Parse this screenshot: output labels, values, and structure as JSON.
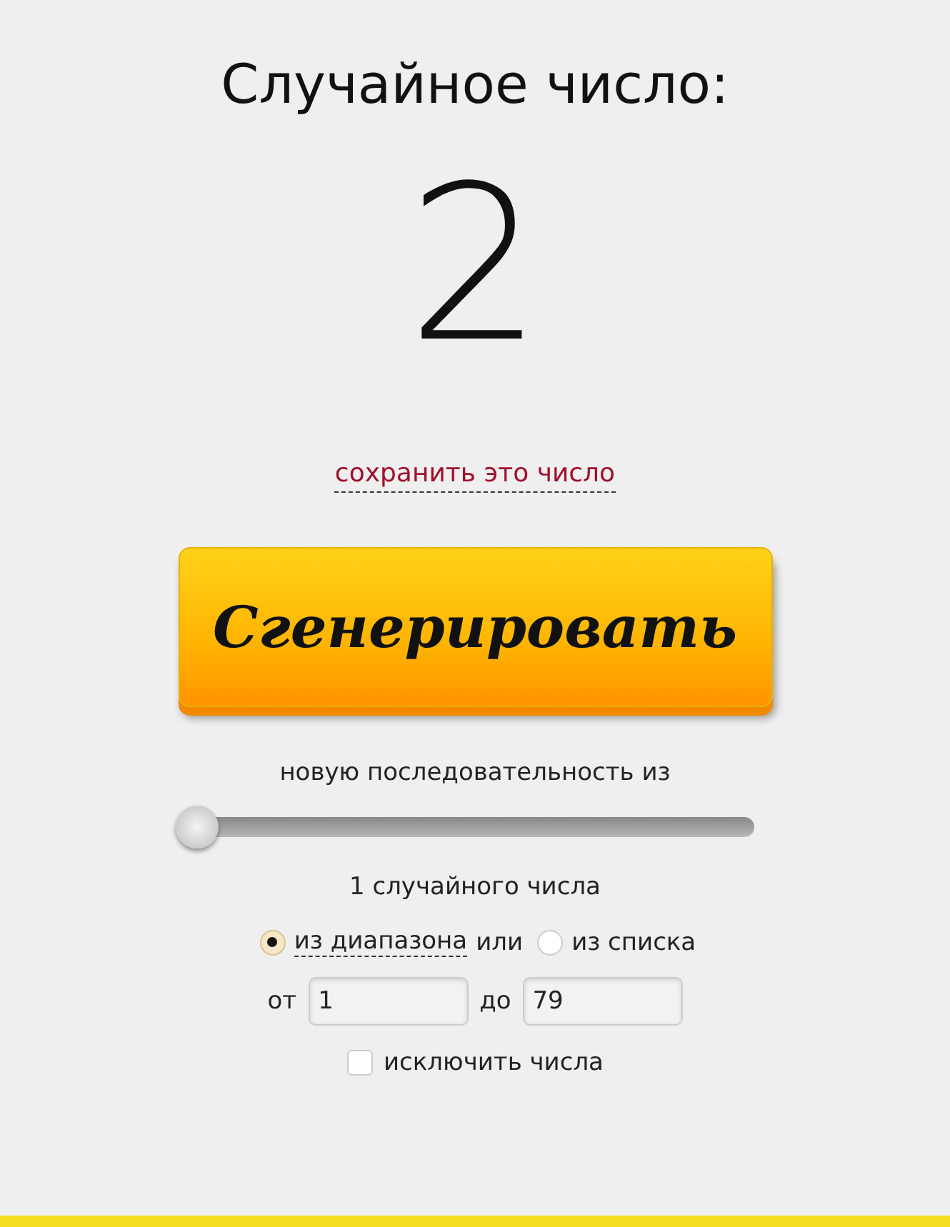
{
  "title": "Случайное число:",
  "result": "2",
  "save_link": "сохранить это число",
  "generate_button": "Сгенерировать",
  "sequence_label": "новую последовательность из",
  "count_slider": {
    "level": 0
  },
  "count_label": "1 случайного числа",
  "source_options": [
    {
      "label": "из диапазона",
      "selected": true,
      "kind": "link"
    },
    {
      "label": "или",
      "kind": "text"
    },
    {
      "label": "из списка",
      "selected": false,
      "kind": "text"
    }
  ],
  "range": {
    "from_label": "от",
    "from_value": "1",
    "to_label": "до",
    "to_value": "79"
  },
  "exclude": {
    "label": "исключить числа",
    "checked": false
  }
}
